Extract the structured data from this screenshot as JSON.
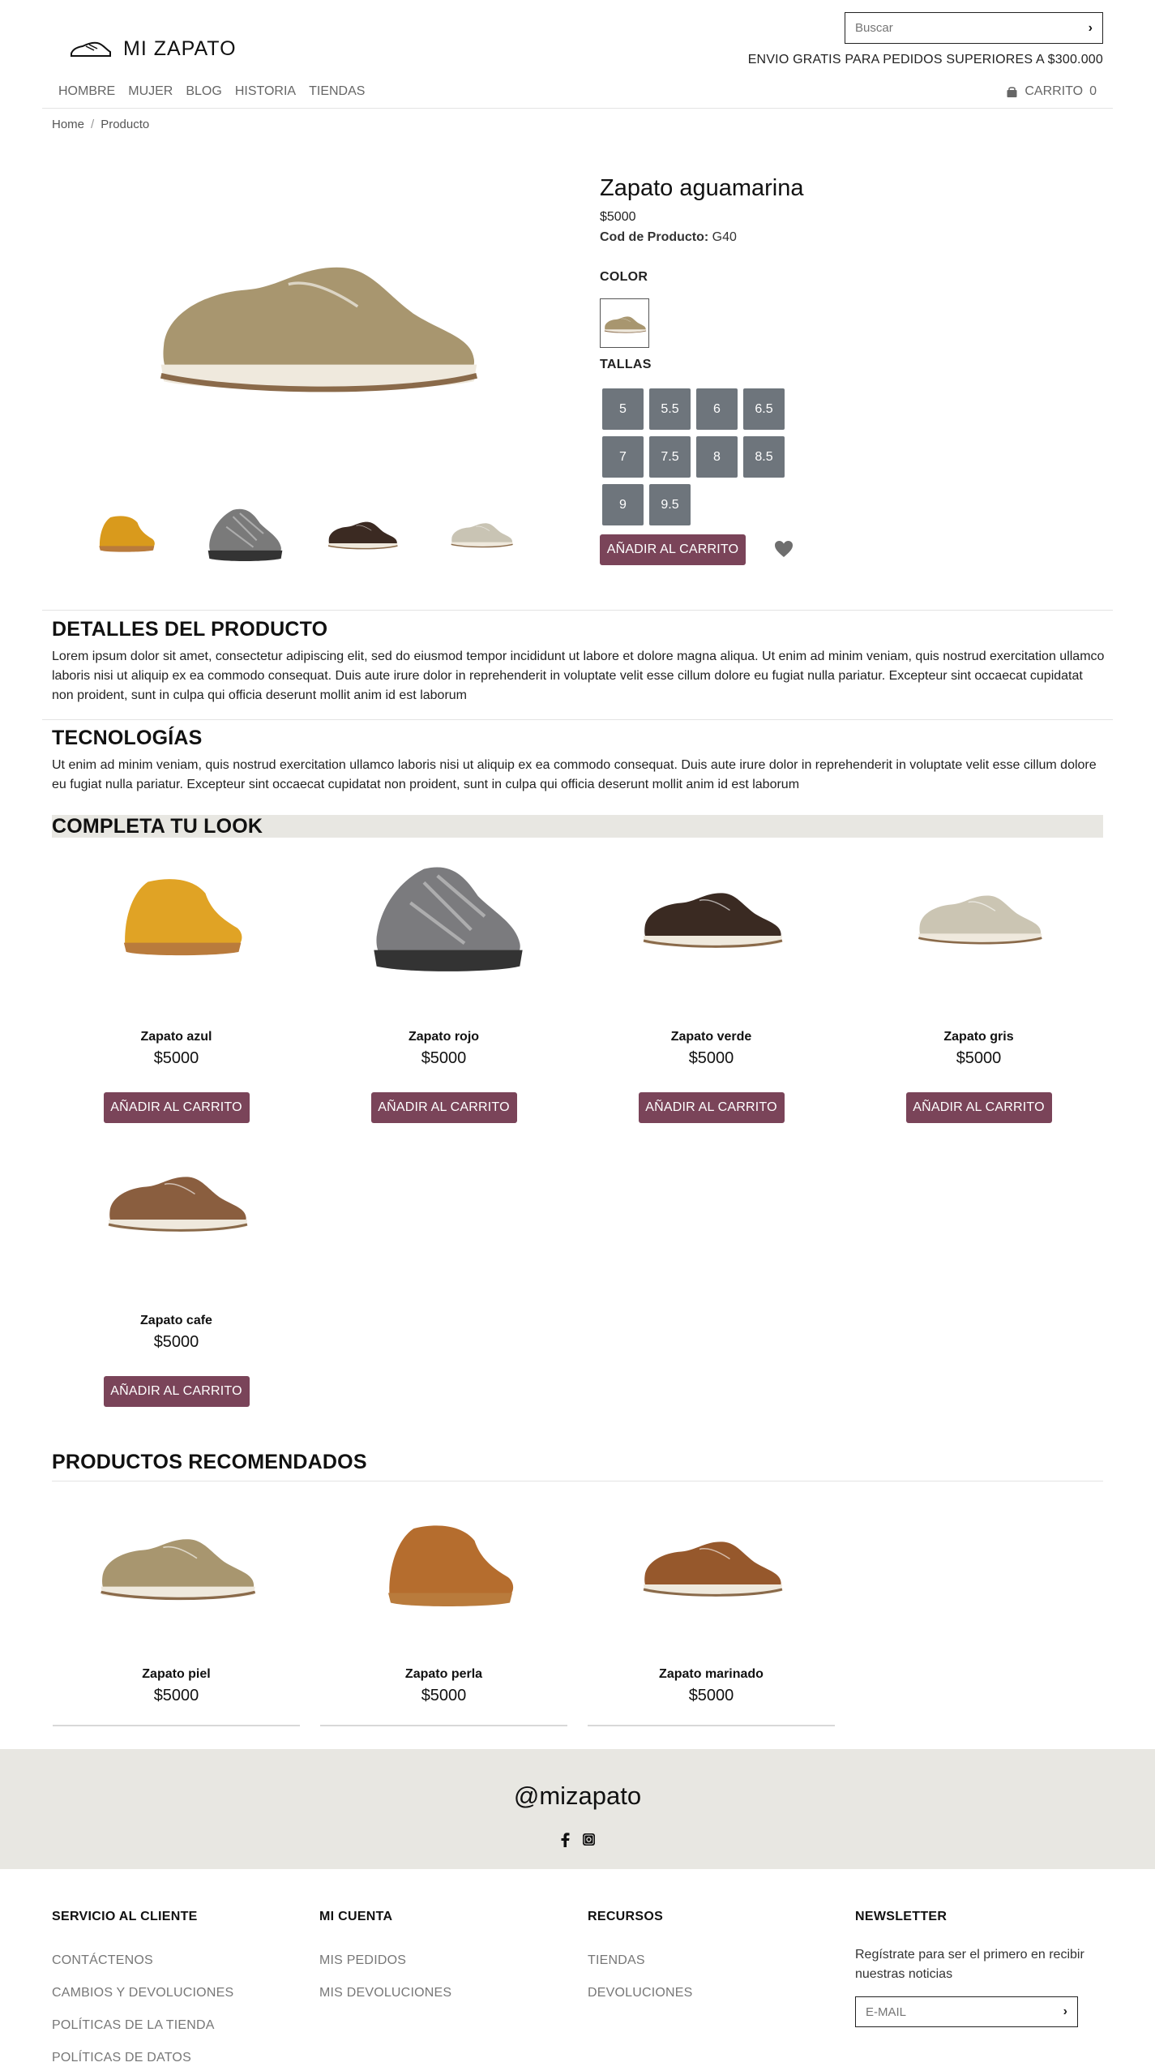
{
  "header": {
    "search_placeholder": "Buscar",
    "logo_text": "MI ZAPATO",
    "promo": "ENVIO GRATIS PARA PEDIDOS SUPERIORES A $300.000",
    "nav": [
      "HOMBRE",
      "MUJER",
      "BLOG",
      "HISTORIA",
      "TIENDAS"
    ],
    "cart_label": "CARRITO",
    "cart_count": "0"
  },
  "breadcrumb": {
    "home": "Home",
    "sep": "/",
    "current": "Producto"
  },
  "product": {
    "title": "Zapato aguamarina",
    "price": "$5000",
    "code_label": "Cod de Producto:",
    "code_value": "G40",
    "color_label": "COLOR",
    "sizes_label": "TALLAS",
    "sizes": [
      "5",
      "5.5",
      "6",
      "6.5",
      "7",
      "7.5",
      "8",
      "8.5",
      "9",
      "9.5"
    ],
    "add_label": "AÑADIR AL CARRITO"
  },
  "details": {
    "title": "DETALLES DEL PRODUCTO",
    "text": "Lorem ipsum dolor sit amet, consectetur adipiscing elit, sed do eiusmod tempor incididunt ut labore et dolore magna aliqua. Ut enim ad minim veniam, quis nostrud exercitation ullamco laboris nisi ut aliquip ex ea commodo consequat. Duis aute irure dolor in reprehenderit in voluptate velit esse cillum dolore eu fugiat nulla pariatur. Excepteur sint occaecat cupidatat non proident, sunt in culpa qui officia deserunt mollit anim id est laborum"
  },
  "tech": {
    "title": "TECNOLOGÍAS",
    "text": "Ut enim ad minim veniam, quis nostrud exercitation ullamco laboris nisi ut aliquip ex ea commodo consequat. Duis aute irure dolor in reprehenderit in voluptate velit esse cillum dolore eu fugiat nulla pariatur. Excepteur sint occaecat cupidatat non proident, sunt in culpa qui officia deserunt mollit anim id est laborum"
  },
  "look": {
    "title": "COMPLETA TU LOOK",
    "items": [
      {
        "name": "Zapato azul",
        "price": "$5000",
        "button": "AÑADIR AL CARRITO"
      },
      {
        "name": "Zapato rojo",
        "price": "$5000",
        "button": "AÑADIR AL CARRITO"
      },
      {
        "name": "Zapato verde",
        "price": "$5000",
        "button": "AÑADIR AL CARRITO"
      },
      {
        "name": "Zapato gris",
        "price": "$5000",
        "button": "AÑADIR AL CARRITO"
      },
      {
        "name": "Zapato cafe",
        "price": "$5000",
        "button": "AÑADIR AL CARRITO"
      }
    ]
  },
  "recommended": {
    "title": "PRODUCTOS RECOMENDADOS",
    "items": [
      {
        "name": "Zapato piel",
        "price": "$5000"
      },
      {
        "name": "Zapato perla",
        "price": "$5000"
      },
      {
        "name": "Zapato marinado",
        "price": "$5000"
      }
    ]
  },
  "social": {
    "handle": "@mizapato",
    "icons": [
      "facebook-icon",
      "instagram-icon"
    ]
  },
  "footer": {
    "service": {
      "title": "SERVICIO AL CLIENTE",
      "links": [
        "CONTÁCTENOS",
        "CAMBIOS Y DEVOLUCIONES",
        "POLÍTICAS DE LA TIENDA",
        "POLÍTICAS DE DATOS"
      ]
    },
    "account": {
      "title": "MI CUENTA",
      "links": [
        "MIS PEDIDOS",
        "MIS DEVOLUCIONES"
      ]
    },
    "resources": {
      "title": "RECURSOS",
      "links": [
        "TIENDAS",
        "DEVOLUCIONES"
      ]
    },
    "newsletter": {
      "title": "NEWSLETTER",
      "text": "Regístrate para ser el primero en recibir nuestras noticias",
      "placeholder": "E-MAIL"
    }
  },
  "colors": {
    "accent": "#7a4459",
    "size_bg": "#6e757c",
    "band": "#e8e7e2"
  }
}
